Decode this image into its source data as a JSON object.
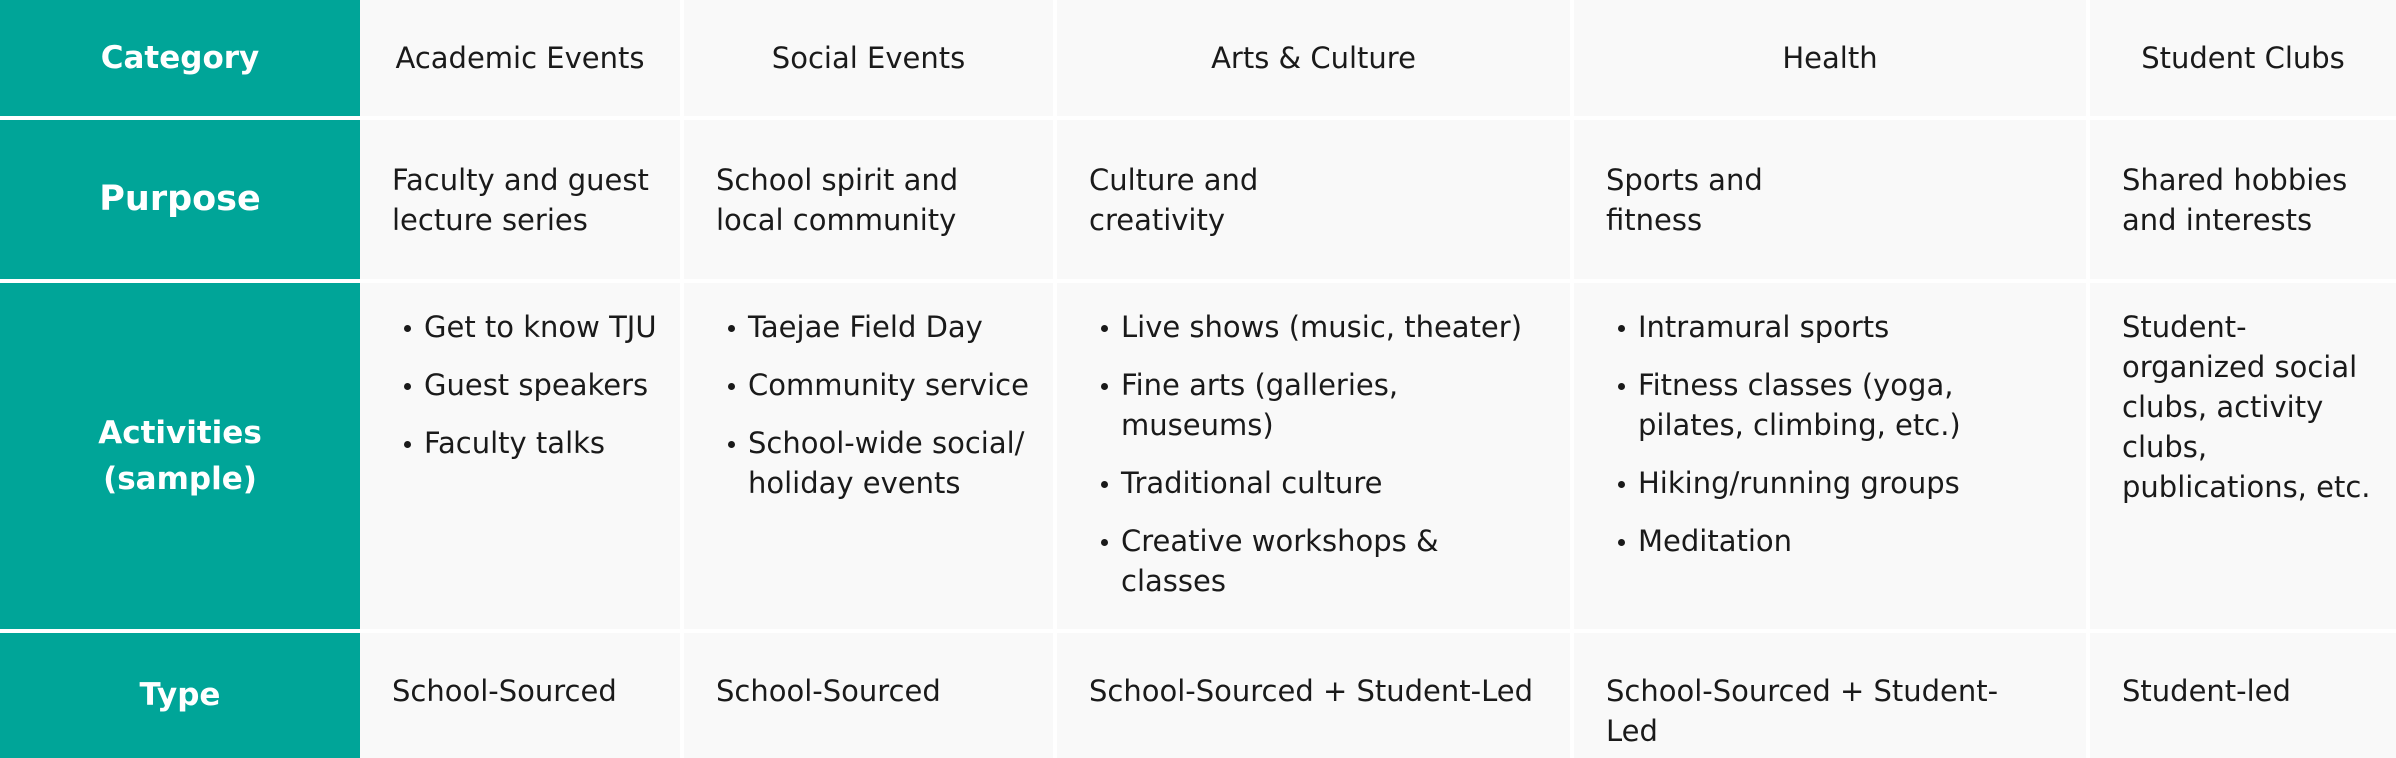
{
  "headers": {
    "category": "Category",
    "purpose": "Purpose",
    "activities": "Activities (sample)",
    "type": "Type"
  },
  "columns": [
    {
      "category": "Academic Events",
      "purpose": "Faculty and guest lecture series",
      "activities": [
        "Get to know TJU",
        "Guest speakers",
        "Faculty talks"
      ],
      "type": "School-Sourced"
    },
    {
      "category": "Social Events",
      "purpose": "School spirit and local community",
      "activities": [
        "Taejae Field Day",
        "Community service",
        "School-wide social/ holiday events"
      ],
      "type": "School-Sourced"
    },
    {
      "category": "Arts & Culture",
      "purpose": "Culture and creativity",
      "activities": [
        "Live shows (music, theater)",
        "Fine arts (galleries, museums)",
        "Traditional culture",
        "Creative workshops & classes"
      ],
      "type": "School-Sourced + Student-Led"
    },
    {
      "category": "Health",
      "purpose": "Sports and fitness",
      "activities": [
        "Intramural sports",
        "Fitness classes (yoga, pilates, climbing, etc.)",
        "Hiking/running groups",
        "Meditation"
      ],
      "type": "School-Sourced + Student-Led"
    },
    {
      "category": "Student Clubs",
      "purpose": "Shared hobbies and interests",
      "activities_text": "Student-organized social clubs, activity clubs, publications, etc.",
      "type": "Student-led"
    }
  ],
  "colors": {
    "header_bg": "#00a598",
    "cell_bg": "#f9f9f9",
    "divider": "#ffffff"
  }
}
